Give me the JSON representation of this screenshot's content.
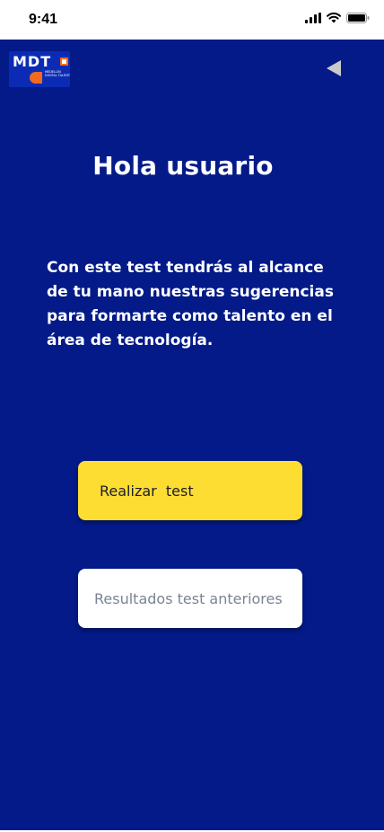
{
  "status_bar": {
    "time": "9:41"
  },
  "logo": {
    "text": "MDT",
    "subtitle": "MEDELLÍN DIGITAL TALENT"
  },
  "header": {
    "title": "Hola usuario"
  },
  "main": {
    "description": " Con este test tendrás al alcance de tu mano nuestras sugerencias para formarte como talento en el área de tecnología.",
    "primary_button": "Realizar  test",
    "secondary_button": "Resultados test anteriores"
  },
  "colors": {
    "background": "#031a88",
    "primary_button": "#fddd32",
    "secondary_button": "#ffffff",
    "logo_accent": "#f36a1f"
  },
  "icons": [
    "signal-icon",
    "wifi-icon",
    "battery-icon",
    "back-triangle-icon"
  ]
}
